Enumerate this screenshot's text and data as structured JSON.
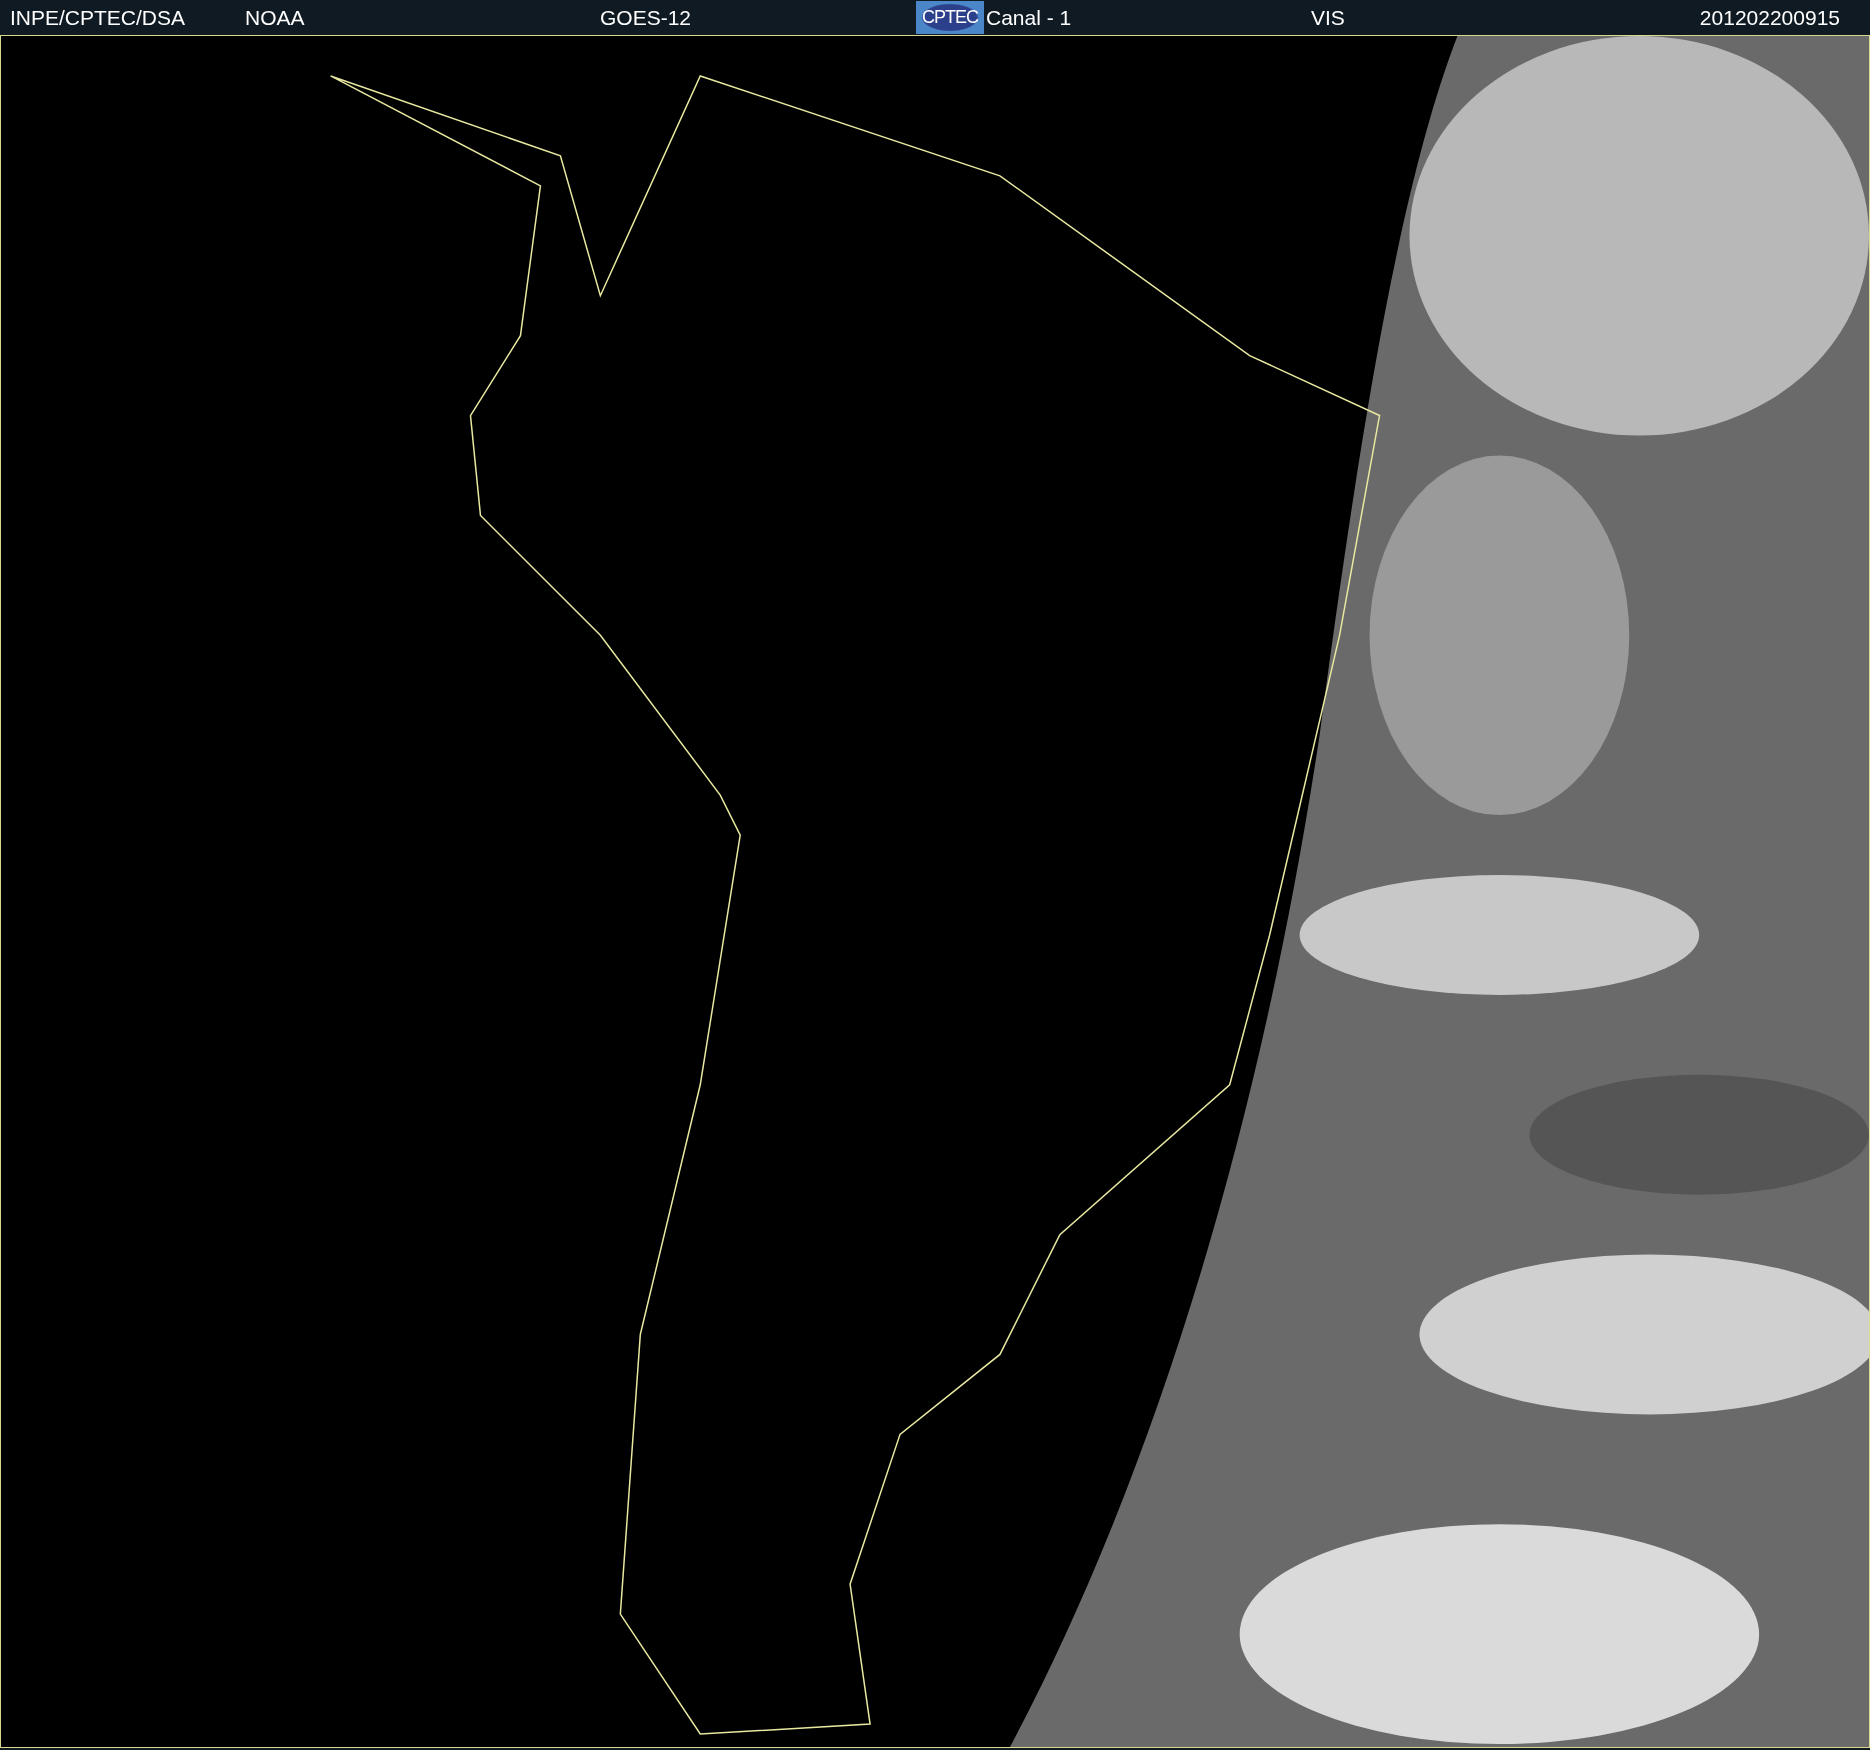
{
  "header": {
    "source": "INPE/CPTEC/DSA",
    "agency": "NOAA",
    "satellite": "GOES-12",
    "logo_text": "CPTEC",
    "channel": "Canal - 1",
    "band": "VIS",
    "timestamp": "201202200915"
  }
}
